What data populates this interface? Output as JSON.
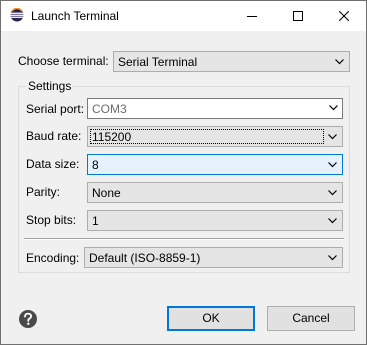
{
  "window": {
    "title": "Launch Terminal"
  },
  "terminal": {
    "label": "Choose terminal:",
    "value": "Serial Terminal"
  },
  "settings": {
    "group_title": "Settings",
    "serial_port": {
      "label": "Serial port:",
      "value": "COM3"
    },
    "baud_rate": {
      "label": "Baud rate:",
      "value": "115200"
    },
    "data_size": {
      "label": "Data size:",
      "value": "8"
    },
    "parity": {
      "label": "Parity:",
      "value": "None"
    },
    "stop_bits": {
      "label": "Stop bits:",
      "value": "1"
    },
    "encoding": {
      "label": "Encoding:",
      "value": "Default (ISO-8859-1)"
    }
  },
  "buttons": {
    "ok": "OK",
    "cancel": "Cancel"
  },
  "icons": {
    "app": "eclipse-icon",
    "help": "help-icon"
  },
  "colors": {
    "accent": "#0078d7",
    "dialog_bg": "#f0f0f0",
    "titlebar_bg": "#ffffff"
  }
}
